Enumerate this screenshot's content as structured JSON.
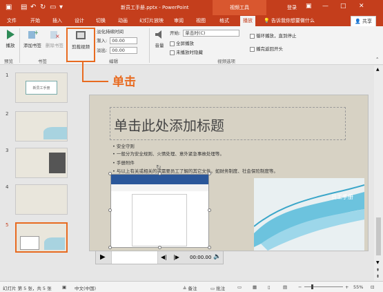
{
  "window": {
    "doc_title": "新员工手册.pptx - PowerPoint",
    "context_tab": "视频工具",
    "login": "登录",
    "share": "共享",
    "tell_me": "告诉我你想要做什么"
  },
  "tabs": [
    "文件",
    "开始",
    "插入",
    "设计",
    "切换",
    "动画",
    "幻灯片放映",
    "审阅",
    "视图",
    "格式",
    "播放"
  ],
  "active_tab": "播放",
  "ribbon": {
    "play_label": "播放",
    "add_bookmark": "添加书签",
    "remove_bookmark": "删除书签",
    "trim_video": "剪裁视频",
    "fade_duration": "淡化持续时间",
    "fade_in_label": "渐入:",
    "fade_in_value": "00.00",
    "fade_out_label": "淡出:",
    "fade_out_value": "00.00",
    "volume": "音量",
    "start_label": "开始:",
    "start_value": "单击时(C)",
    "fullscreen": "全屏播放",
    "hide_when_not_playing": "未播放时隐藏",
    "loop_until_stopped": "循环播放，直到停止",
    "rewind_after_playing": "播完返回开头",
    "groups": {
      "preview": "预览",
      "bookmarks": "书签",
      "editing": "编辑",
      "video_options": "视频选项"
    }
  },
  "callout": "单击",
  "slides": [
    "1",
    "2",
    "3",
    "4",
    "5"
  ],
  "slide1_text": "新员工手册",
  "main_slide": {
    "title": "单击此处添加标题",
    "bullets": [
      "安全守则",
      "一般分为安全规则、火情处理、意外紧急事故处理等。",
      "手册附件",
      "与以上有关或相关的或需要员工了解的其它文件。如财务制度、社会保险制度等。"
    ],
    "picture_caption": "员工手册"
  },
  "video_bar": {
    "time": "00:00.00"
  },
  "status": {
    "slide_info": "幻灯片 第 5 张，共 5 张",
    "language": "中文(中国)",
    "notes": "备注",
    "comments": "批注",
    "zoom": "55%"
  }
}
